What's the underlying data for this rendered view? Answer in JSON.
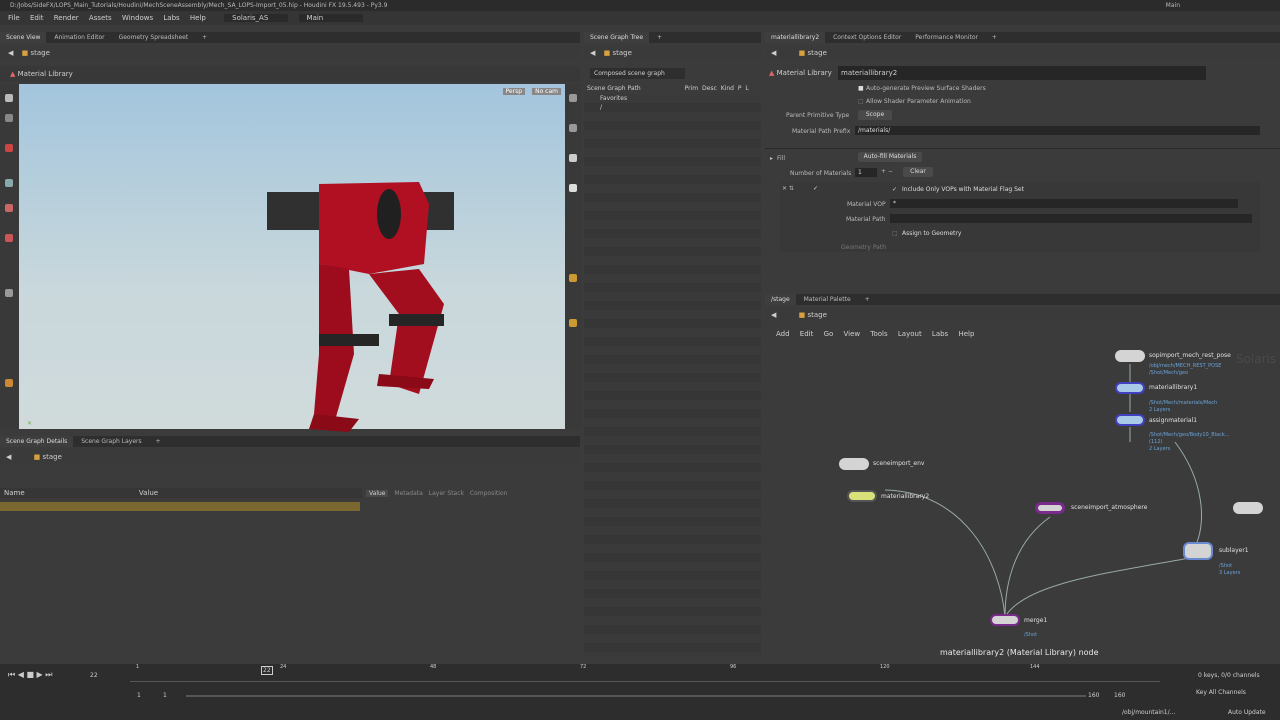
{
  "window": {
    "title": "D:/Jobs/SideFX/LOPS_Main_Tutorials/Houdini/MechSceneAssembly/Mech_SA_LOPS-Import_05.hip - Houdini FX 19.5.493 - Py3.9",
    "desktop": "Main"
  },
  "menu": [
    "File",
    "Edit",
    "Render",
    "Assets",
    "Windows",
    "Labs",
    "Help"
  ],
  "desktop_select": "Solaris_AS",
  "context_select": "Main",
  "left_tabs": [
    "Scene View",
    "Animation Editor",
    "Geometry Spreadsheet"
  ],
  "left_path": "stage",
  "material_library_label": "Material Library",
  "viewport": {
    "persp": "Persp",
    "cam": "No cam"
  },
  "sgt": {
    "tabs": [
      "Scene Graph Tree"
    ],
    "path": "stage",
    "mode": "Composed scene graph",
    "columns": [
      "Scene Graph Path",
      "Prim",
      "Desc",
      "Kind",
      "P",
      "L"
    ],
    "rows": [
      "Favorites",
      "/"
    ]
  },
  "params": {
    "tabs": [
      "materiallibrary2",
      "Context Options Editor",
      "Performance Monitor"
    ],
    "path": "stage",
    "type": "Material Library",
    "name": "materiallibrary2",
    "auto_gen": "Auto-generate Preview Surface Shaders",
    "allow_anim": "Allow Shader Parameter Animation",
    "parent_prim_label": "Parent Primitive Type",
    "parent_prim_value": "Scope",
    "prefix_label": "Material Path Prefix",
    "prefix_value": "/materials/",
    "fill": "Fill",
    "autofill": "Auto-fill Materials",
    "num_label": "Number of Materials",
    "num_value": "1",
    "clear": "Clear",
    "include_only": "Include Only VOPs with Material Flag Set",
    "vop_label": "Material VOP",
    "vop_value": "*",
    "matpath_label": "Material Path",
    "assign": "Assign to Geometry",
    "geo_path": "Geometry Path"
  },
  "network": {
    "tabs": [
      "/stage",
      "Material Palette"
    ],
    "path": "stage",
    "menu": [
      "Add",
      "Edit",
      "Go",
      "View",
      "Tools",
      "Layout",
      "Labs",
      "Help"
    ],
    "watermark": "Solaris",
    "caption": "materiallibrary2 (Material Library) node",
    "nodes": [
      {
        "name": "sopimport_mech_rest_pose",
        "sub": [
          "/obj/mech/MECH_REST_POSE",
          "/Shot/Mech/geo"
        ]
      },
      {
        "name": "materiallibrary1",
        "sub": [
          "/Shot/Mech/materials/Mech",
          "2 Layers"
        ]
      },
      {
        "name": "assignmaterial1",
        "sub": [
          "/Shot/Mech/geo/Body10_Black...",
          "(112)",
          "2 Layers"
        ]
      },
      {
        "name": "sceneimport_env",
        "sub": []
      },
      {
        "name": "materiallibrary2",
        "sub": []
      },
      {
        "name": "sceneimport_atmosphere",
        "sub": []
      },
      {
        "name": "sublayer1",
        "sub": [
          "/Shot",
          "3 Layers"
        ]
      },
      {
        "name": "merge1",
        "sub": [
          "/Shot"
        ]
      }
    ]
  },
  "details": {
    "tabs": [
      "Scene Graph Details",
      "Scene Graph Layers"
    ],
    "path": "stage",
    "cols": [
      "Name",
      "Value"
    ],
    "subtabs": [
      "Value",
      "Metadata",
      "Layer Stack",
      "Composition"
    ]
  },
  "timeline": {
    "frame": "22",
    "ticks": [
      "1",
      "24",
      "48",
      "72",
      "96",
      "120",
      "144"
    ],
    "start": "1",
    "start2": "1",
    "end": "160",
    "end2": "160",
    "keys": "0 keys, 0/0 channels",
    "key_all": "Key All Channels",
    "auto": "Auto Update",
    "status": "/obj/mountain1/..."
  }
}
